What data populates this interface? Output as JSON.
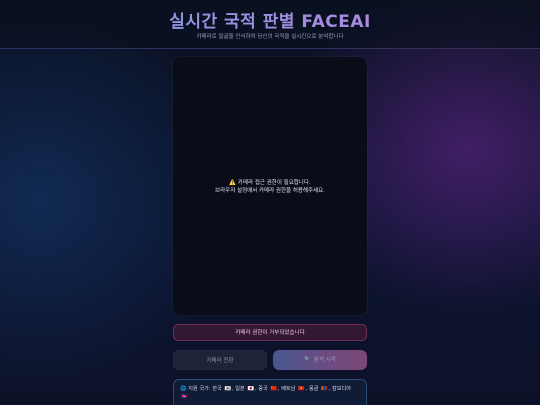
{
  "header": {
    "title": "실시간 국적 판별 FACEAI",
    "subtitle": "카메라로 얼굴을 인식하여 당신의 국적을 실시간으로 분석합니다"
  },
  "video": {
    "warning_icon": "warning-icon",
    "message_line1": "카메라 접근 권한이 필요합니다.",
    "message_line2": "브라우저 설정에서 카메라 권한을 허용해주세요."
  },
  "error": {
    "text": "카메라 권한이 거부되었습니다"
  },
  "buttons": {
    "switch_camera": "카메라 전환",
    "start_analysis": "분석 시작",
    "start_icon": "magnifier-icon"
  },
  "countries": {
    "prefix": "지원 국가:",
    "items": [
      {
        "name": "한국",
        "flag": "🇰🇷"
      },
      {
        "name": "일본",
        "flag": "🇯🇵"
      },
      {
        "name": "중국",
        "flag": "🇨🇳"
      },
      {
        "name": "베트남",
        "flag": "🇻🇳"
      },
      {
        "name": "몽골",
        "flag": "🇲🇳"
      },
      {
        "name": "캄보디아",
        "flag": "🇰🇭"
      }
    ]
  }
}
